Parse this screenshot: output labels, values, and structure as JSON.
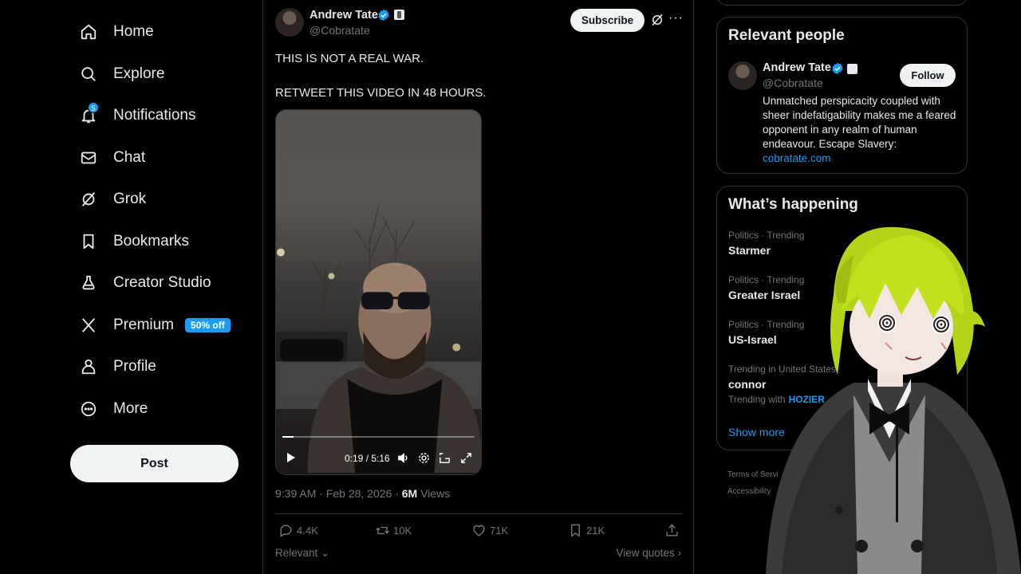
{
  "nav": {
    "items": [
      {
        "label": "Home",
        "icon": "home-icon"
      },
      {
        "label": "Explore",
        "icon": "search-icon"
      },
      {
        "label": "Notifications",
        "icon": "bell-icon",
        "badge": "5"
      },
      {
        "label": "Chat",
        "icon": "mail-icon"
      },
      {
        "label": "Grok",
        "icon": "grok-icon"
      },
      {
        "label": "Bookmarks",
        "icon": "bookmark-icon"
      },
      {
        "label": "Creator Studio",
        "icon": "creator-studio-icon"
      },
      {
        "label": "Premium",
        "icon": "x-logo-icon",
        "badge": "50% off"
      },
      {
        "label": "Profile",
        "icon": "person-icon"
      },
      {
        "label": "More",
        "icon": "more-circle-icon"
      }
    ],
    "post_button": "Post"
  },
  "tweet": {
    "author_name": "Andrew Tate",
    "handle": "@Cobratate",
    "subscribe_label": "Subscribe",
    "text": "THIS IS NOT A REAL WAR.\n\nRETWEET THIS VIDEO IN 48 HOURS.",
    "video": {
      "time": "0:19 / 5:16",
      "progress": 0.06
    },
    "timestamp": "9:39 AM · Feb 28, 2026 · ",
    "views_count": "6M",
    "views_label": "Views",
    "actions": {
      "replies": "4.4K",
      "reposts": "10K",
      "likes": "71K",
      "bookmarks": "21K"
    },
    "sort_label": "Relevant",
    "view_quotes": "View quotes"
  },
  "relevant_people": {
    "title": "Relevant people",
    "name": "Andrew Tate",
    "handle": "@Cobratate",
    "follow_label": "Follow",
    "bio": "Unmatched perspicacity coupled with sheer indefatigability makes me a feared opponent in any realm of human endeavour. Escape Slavery: ",
    "bio_link": "cobratate.com"
  },
  "whats_happening": {
    "title": "What’s happening",
    "trends": [
      {
        "meta": "Politics · Trending",
        "name": "Starmer"
      },
      {
        "meta": "Politics · Trending",
        "name": "Greater Israel"
      },
      {
        "meta": "Politics · Trending",
        "name": "US-Israel"
      },
      {
        "meta": "Trending in United States",
        "name": "connor",
        "with_label": "Trending with",
        "with_tag": "HOZIER"
      }
    ],
    "show_more": "Show more"
  },
  "footer": {
    "line1": "Terms of Servi",
    "line2": "Accessibility"
  },
  "colors": {
    "accent": "#1d9bf0",
    "background": "#000000",
    "text": "#e7e9ea",
    "muted": "#71767b"
  }
}
